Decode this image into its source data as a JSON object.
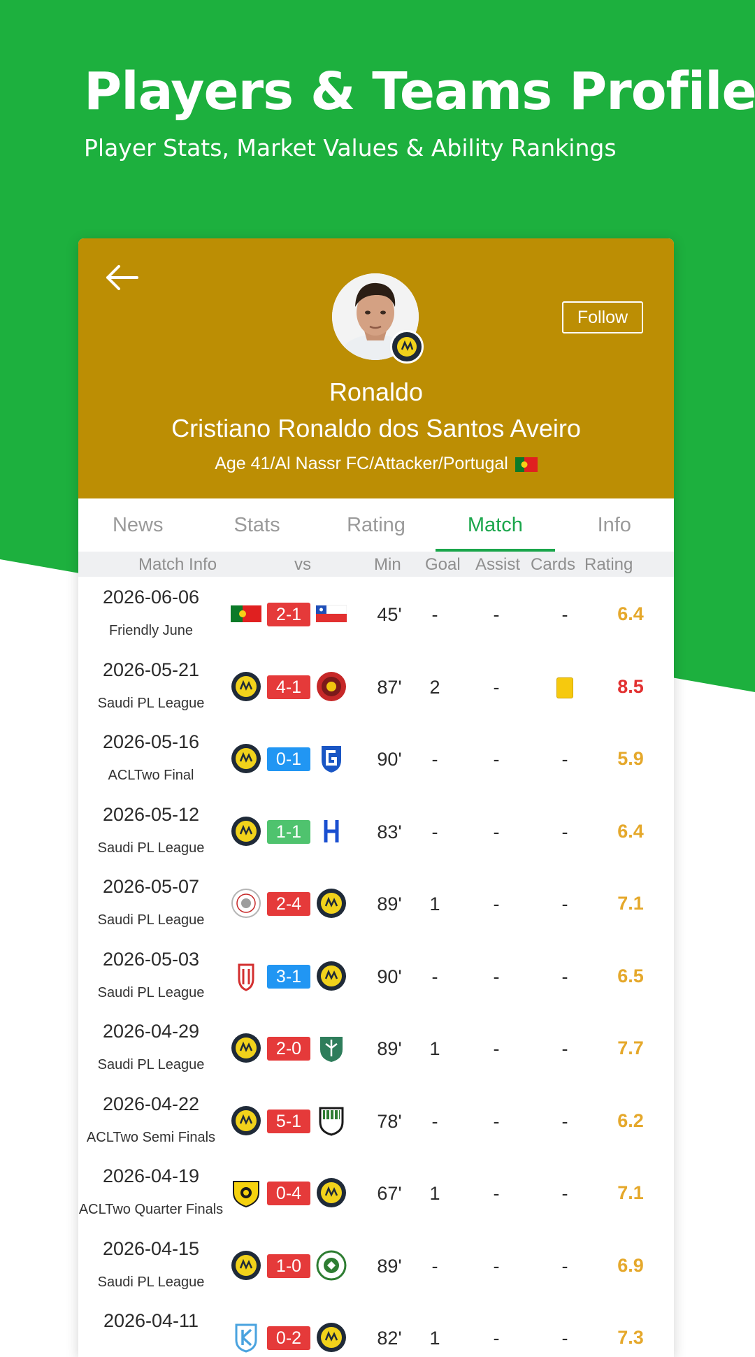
{
  "hero": {
    "title": "Players & Teams Profiles",
    "subtitle": "Player Stats, Market Values & Ability Rankings"
  },
  "player": {
    "short_name": "Ronaldo",
    "full_name": "Cristiano Ronaldo dos Santos Aveiro",
    "meta": "Age 41/Al Nassr FC/Attacker/Portugal",
    "follow_label": "Follow"
  },
  "tabs": [
    {
      "label": "News",
      "active": false
    },
    {
      "label": "Stats",
      "active": false
    },
    {
      "label": "Rating",
      "active": false
    },
    {
      "label": "Match",
      "active": true
    },
    {
      "label": "Info",
      "active": false
    }
  ],
  "columns": {
    "match_info": "Match Info",
    "vs": "vs",
    "min": "Min",
    "goal": "Goal",
    "assist": "Assist",
    "cards": "Cards",
    "rating": "Rating"
  },
  "colors": {
    "score_loss": "#e53a3a",
    "score_win": "#2196f3",
    "score_draw": "#4fc36e",
    "rating_gold": "#e5a82b",
    "rating_red": "#e23030"
  },
  "matches": [
    {
      "date": "2026-06-06",
      "competition": "Friendly June",
      "home": "portugal-flag",
      "away": "chile-flag",
      "score": "2-1",
      "result": "loss",
      "min": "45'",
      "goal": "-",
      "assist": "-",
      "cards": "-",
      "rating": "6.4",
      "rating_color": "gold"
    },
    {
      "date": "2026-05-21",
      "competition": "Saudi PL League",
      "home": "al-nassr-crest",
      "away": "red-club-crest",
      "score": "4-1",
      "result": "loss",
      "min": "87'",
      "goal": "2",
      "assist": "-",
      "cards": "yellow",
      "rating": "8.5",
      "rating_color": "red"
    },
    {
      "date": "2026-05-16",
      "competition": "ACLTwo Final",
      "home": "al-nassr-crest",
      "away": "gamba-crest",
      "score": "0-1",
      "result": "win",
      "min": "90'",
      "goal": "-",
      "assist": "-",
      "cards": "-",
      "rating": "5.9",
      "rating_color": "gold"
    },
    {
      "date": "2026-05-12",
      "competition": "Saudi PL League",
      "home": "al-nassr-crest",
      "away": "al-hilal-crest",
      "score": "1-1",
      "result": "draw",
      "min": "83'",
      "goal": "-",
      "assist": "-",
      "cards": "-",
      "rating": "6.4",
      "rating_color": "gold"
    },
    {
      "date": "2026-05-07",
      "competition": "Saudi PL League",
      "home": "white-club-crest",
      "away": "al-nassr-crest",
      "score": "2-4",
      "result": "loss",
      "min": "89'",
      "goal": "1",
      "assist": "-",
      "cards": "-",
      "rating": "7.1",
      "rating_color": "gold"
    },
    {
      "date": "2026-05-03",
      "competition": "Saudi PL League",
      "home": "red-shield-crest",
      "away": "al-nassr-crest",
      "score": "3-1",
      "result": "win",
      "min": "90'",
      "goal": "-",
      "assist": "-",
      "cards": "-",
      "rating": "6.5",
      "rating_color": "gold"
    },
    {
      "date": "2026-04-29",
      "competition": "Saudi PL League",
      "home": "al-nassr-crest",
      "away": "green-shield-crest",
      "score": "2-0",
      "result": "loss",
      "min": "89'",
      "goal": "1",
      "assist": "-",
      "cards": "-",
      "rating": "7.7",
      "rating_color": "gold"
    },
    {
      "date": "2026-04-22",
      "competition": "ACLTwo Semi Finals",
      "home": "al-nassr-crest",
      "away": "striped-shield-crest",
      "score": "5-1",
      "result": "loss",
      "min": "78'",
      "goal": "-",
      "assist": "-",
      "cards": "-",
      "rating": "6.2",
      "rating_color": "gold"
    },
    {
      "date": "2026-04-19",
      "competition": "ACLTwo Quarter Finals",
      "home": "yellow-shield-crest",
      "away": "al-nassr-crest",
      "score": "0-4",
      "result": "loss",
      "min": "67'",
      "goal": "1",
      "assist": "-",
      "cards": "-",
      "rating": "7.1",
      "rating_color": "gold"
    },
    {
      "date": "2026-04-15",
      "competition": "Saudi PL League",
      "home": "al-nassr-crest",
      "away": "green-round-crest",
      "score": "1-0",
      "result": "loss",
      "min": "89'",
      "goal": "-",
      "assist": "-",
      "cards": "-",
      "rating": "6.9",
      "rating_color": "gold"
    },
    {
      "date": "2026-04-11",
      "competition": "",
      "home": "blue-k-crest",
      "away": "al-nassr-crest",
      "score": "0-2",
      "result": "loss",
      "min": "82'",
      "goal": "1",
      "assist": "-",
      "cards": "-",
      "rating": "7.3",
      "rating_color": "gold"
    }
  ]
}
